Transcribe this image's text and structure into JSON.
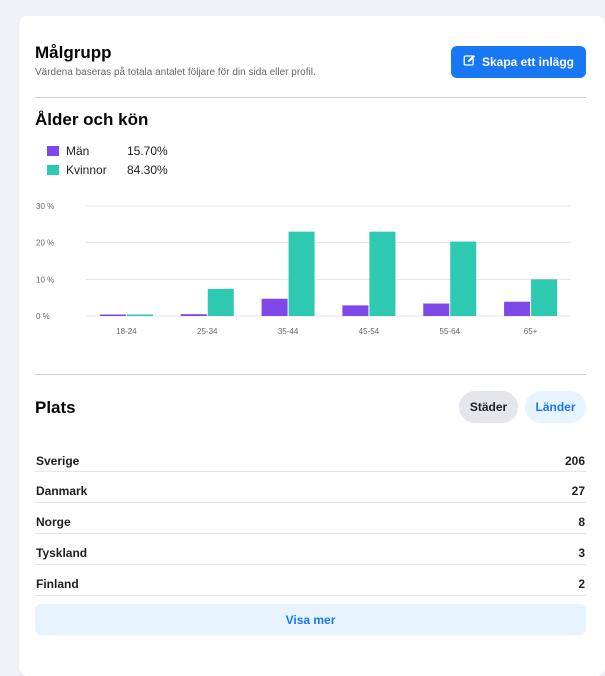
{
  "header": {
    "title": "Målgrupp",
    "subtitle": "Värdena baseras på totala antalet följare för din sida eller profil.",
    "create_post_label": "Skapa ett inlägg",
    "create_post_icon": "edit-icon"
  },
  "age_gender": {
    "title": "Ålder och kön",
    "legend": [
      {
        "label": "Män",
        "value": "15.70%",
        "color": "#7f48e8"
      },
      {
        "label": "Kvinnor",
        "value": "84.30%",
        "color": "#2ec9b1"
      }
    ]
  },
  "chart_data": {
    "type": "bar",
    "categories": [
      "18-24",
      "25-34",
      "35-44",
      "45-54",
      "55-64",
      "65+"
    ],
    "series": [
      {
        "name": "Män",
        "values": [
          0.2,
          0.5,
          4.7,
          2.9,
          3.4,
          3.9
        ]
      },
      {
        "name": "Kvinnor",
        "values": [
          0.4,
          7.4,
          23.0,
          23.0,
          20.3,
          10.0
        ]
      }
    ],
    "yticks": [
      "30 %",
      "20 %",
      "10 %",
      "0 %"
    ],
    "ylim": [
      0,
      30
    ],
    "grid": true
  },
  "location": {
    "title": "Plats",
    "tabs": [
      {
        "label": "Städer",
        "active": true
      },
      {
        "label": "Länder",
        "active": false
      }
    ],
    "rows": [
      {
        "name": "Sverige",
        "count": "206"
      },
      {
        "name": "Danmark",
        "count": "27"
      },
      {
        "name": "Norge",
        "count": "8"
      },
      {
        "name": "Tyskland",
        "count": "3"
      },
      {
        "name": "Finland",
        "count": "2"
      }
    ],
    "show_more_label": "Visa mer"
  }
}
